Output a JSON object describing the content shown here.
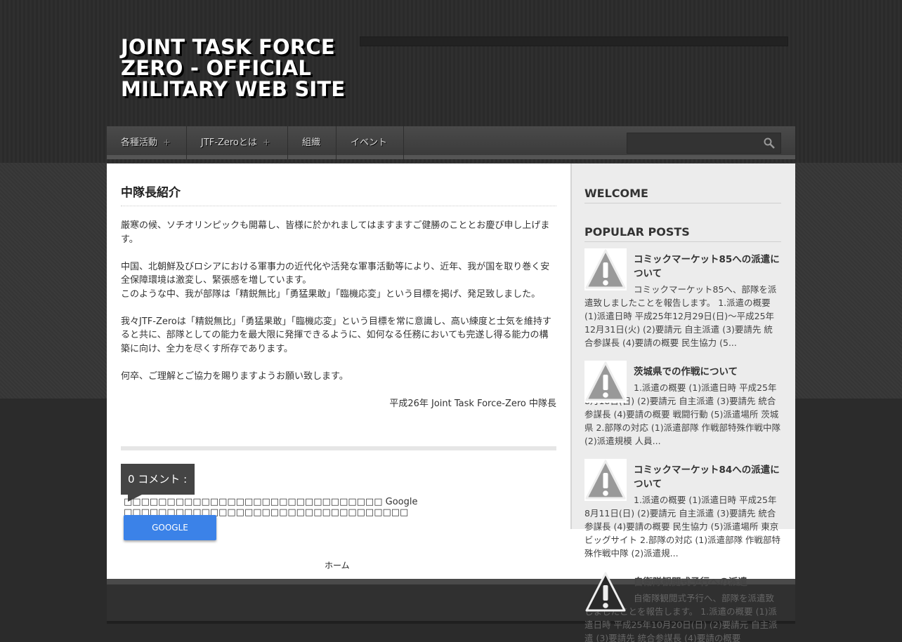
{
  "site": {
    "title_line1": "JOINT TASK FORCE",
    "title_line2": "ZERO - OFFICIAL",
    "title_line3": "MILITARY WEB SITE"
  },
  "nav": {
    "items": [
      {
        "label": "各種活動",
        "has_submenu": "+"
      },
      {
        "label": "JTF-Zeroとは",
        "has_submenu": "+"
      },
      {
        "label": "組織"
      },
      {
        "label": "イベント"
      }
    ],
    "search_icon": "magnifier-icon"
  },
  "post": {
    "title": "中隊長紹介",
    "paragraphs": [
      "厳寒の候、ソチオリンピックも開幕し、皆様に於かれましてはますますご健勝のこととお慶び申し上げます。",
      "中国、北朝鮮及びロシアにおける軍事力の近代化や活発な軍事活動等により、近年、我が国を取り巻く安全保障環境は激変し、緊張感を増しています。",
      "このような中、我が部隊は「精鋭無比」「勇猛果敢」「臨機応変」という目標を掲げ、発足致しました。",
      "我々JTF-Zeroは「精鋭無比」「勇猛果敢」「臨機応変」という目標を常に意識し、高い練度と士気を維持すると共に、部隊としての能力を最大限に発揮できるように、如何なる任務においても完遂し得る能力の構築に向け、全力を尽くす所存であります。",
      "何卒、ご理解とご協力を賜りますようお願い致します。"
    ],
    "signature": "平成26年 Joint Task Force-Zero 中隊長"
  },
  "comments": {
    "header": "0 コメント :",
    "note_prefix": "□□□□□□□□□□□□□□□□□□□□□□□□□□□□□□ ",
    "note_google": "Google",
    "note_suffix": " □□□□□□□□□□□□□□□□□□□□□□□□□□□□□□□□□",
    "button_label": "GOOGLE □□□□□□□□□□"
  },
  "footer": {
    "home_link": "ホーム"
  },
  "sidebar": {
    "welcome_title": "WELCOME",
    "popular_title": "POPULAR POSTS",
    "posts": [
      {
        "title": "コミックマーケット85への派遣について",
        "snippet": "コミックマーケット85へ、部隊を派遣致しましたことを報告します。 1.派遣の概要 (1)派遣日時 平成25年12月29日(日)〜平成25年12月31日(火) (2)要請元 自主派遣 (3)要請先 統合参謀長 (4)要請の概要 民生協力 (5..."
      },
      {
        "title": "茨城県での作戦について",
        "snippet": "1.派遣の概要 (1)派遣日時 平成25年8月18日(日) (2)要請元 自主派遣 (3)要請先 統合参謀長 (4)要請の概要 戦闘行動 (5)派遣場所 茨城県 2.部隊の対応 (1)派遣部隊 作戦部特殊作戦中隊 (2)派遣規模 人員..."
      },
      {
        "title": "コミックマーケット84への派遣について",
        "snippet": "1.派遣の概要 (1)派遣日時 平成25年8月11日(日) (2)要請元 自主派遣 (3)要請先 統合参謀長 (4)要請の概要 民生協力 (5)派遣場所 東京ビッグサイト 2.部隊の対応 (1)派遣部隊 作戦部特殊作戦中隊 (2)派遣規..."
      },
      {
        "title": "自衛隊観閲式予行への派遣",
        "snippet": "自衛隊観閲式予行へ、部隊を派遣致しましたことを報告します。 1.派遣の概要 (1)派遣日時 平成25年10月20日(日) (2)要請元 自主派遣 (3)要請先 統合参謀長 (4)要請の概要"
      }
    ],
    "thumb_icon": "warning-triangle-icon"
  }
}
